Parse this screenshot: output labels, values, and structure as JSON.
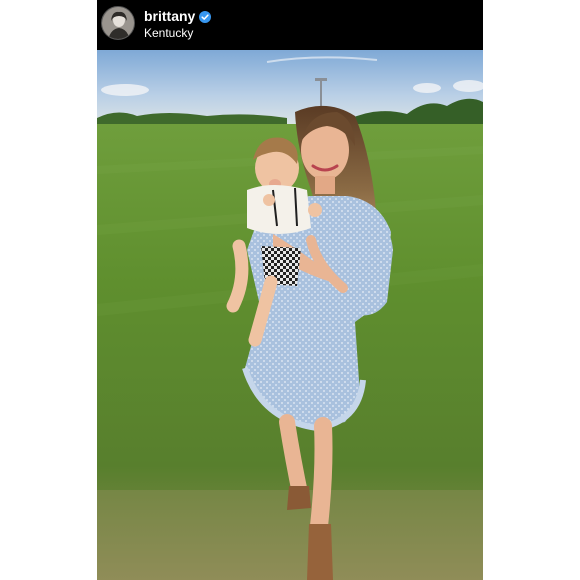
{
  "post": {
    "username": "brittany",
    "verified": true,
    "location": "Kentucky",
    "avatar_icon": "profile-avatar",
    "verified_icon": "verified-badge-icon",
    "photo_description_icon": "photo-mother-holding-baby-in-field"
  },
  "colors": {
    "header_bg": "#000000",
    "verified_blue": "#3897f0",
    "text": "#ffffff"
  }
}
